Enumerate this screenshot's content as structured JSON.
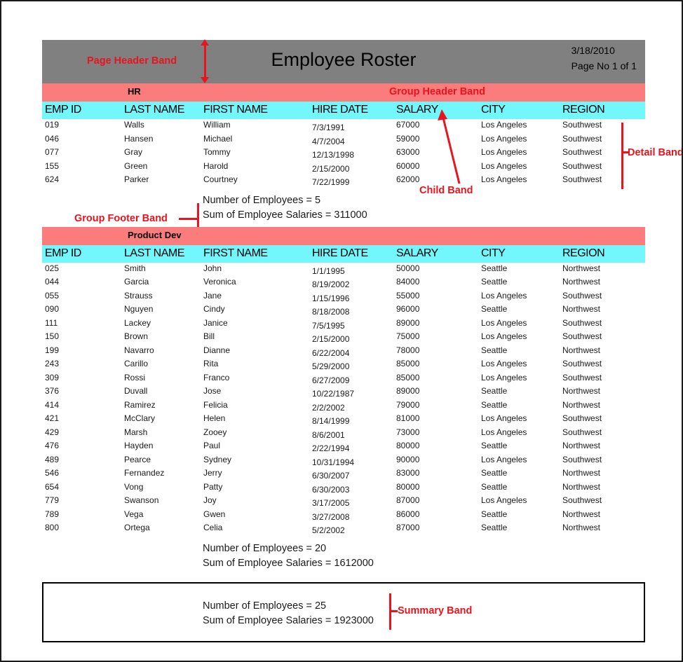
{
  "report": {
    "title": "Employee Roster",
    "date": "3/18/2010",
    "page_no": "Page No 1 of 1",
    "columns": [
      "EMP ID",
      "LAST NAME",
      "FIRST NAME",
      "HIRE DATE",
      "SALARY",
      "CITY",
      "REGION"
    ],
    "groups": [
      {
        "name": "HR",
        "rows": [
          {
            "emp_id": "019",
            "last": "Walls",
            "first": "William",
            "hire": "7/3/1991",
            "salary": "67000",
            "city": "Los Angeles",
            "region": "Southwest"
          },
          {
            "emp_id": "046",
            "last": "Hansen",
            "first": "Michael",
            "hire": "4/7/2004",
            "salary": "59000",
            "city": "Los Angeles",
            "region": "Southwest"
          },
          {
            "emp_id": "077",
            "last": "Gray",
            "first": "Tommy",
            "hire": "12/13/1998",
            "salary": "63000",
            "city": "Los Angeles",
            "region": "Southwest"
          },
          {
            "emp_id": "155",
            "last": "Green",
            "first": "Harold",
            "hire": "2/15/2000",
            "salary": "60000",
            "city": "Los Angeles",
            "region": "Southwest"
          },
          {
            "emp_id": "624",
            "last": "Parker",
            "first": "Courtney",
            "hire": "7/22/1999",
            "salary": "62000",
            "city": "Los Angeles",
            "region": "Southwest"
          }
        ],
        "footer": {
          "count_line": "Number of Employees = 5",
          "sum_line": "Sum of Employee Salaries = 311000"
        }
      },
      {
        "name": "Product Dev",
        "rows": [
          {
            "emp_id": "025",
            "last": "Smith",
            "first": "John",
            "hire": "1/1/1995",
            "salary": "50000",
            "city": "Seattle",
            "region": "Northwest"
          },
          {
            "emp_id": "044",
            "last": "Garcia",
            "first": "Veronica",
            "hire": "8/19/2002",
            "salary": "84000",
            "city": "Seattle",
            "region": "Northwest"
          },
          {
            "emp_id": "055",
            "last": "Strauss",
            "first": "Jane",
            "hire": "1/15/1996",
            "salary": "55000",
            "city": "Los Angeles",
            "region": "Southwest"
          },
          {
            "emp_id": "090",
            "last": "Nguyen",
            "first": "Cindy",
            "hire": "8/18/2008",
            "salary": "96000",
            "city": "Seattle",
            "region": "Northwest"
          },
          {
            "emp_id": "111",
            "last": "Lackey",
            "first": "Janice",
            "hire": "7/5/1995",
            "salary": "89000",
            "city": "Los Angeles",
            "region": "Southwest"
          },
          {
            "emp_id": "150",
            "last": "Brown",
            "first": "Bill",
            "hire": "2/15/2000",
            "salary": "75000",
            "city": "Los Angeles",
            "region": "Southwest"
          },
          {
            "emp_id": "199",
            "last": "Navarro",
            "first": "Dianne",
            "hire": "6/22/2004",
            "salary": "78000",
            "city": "Seattle",
            "region": "Northwest"
          },
          {
            "emp_id": "243",
            "last": "Carillo",
            "first": "Rita",
            "hire": "5/29/2000",
            "salary": "85000",
            "city": "Los Angeles",
            "region": "Southwest"
          },
          {
            "emp_id": "309",
            "last": "Rossi",
            "first": "Franco",
            "hire": "6/27/2009",
            "salary": "85000",
            "city": "Los Angeles",
            "region": "Southwest"
          },
          {
            "emp_id": "376",
            "last": "Duvall",
            "first": "Jose",
            "hire": "10/22/1987",
            "salary": "89000",
            "city": "Seattle",
            "region": "Northwest"
          },
          {
            "emp_id": "414",
            "last": "Ramirez",
            "first": "Felicia",
            "hire": "2/2/2002",
            "salary": "79000",
            "city": "Seattle",
            "region": "Northwest"
          },
          {
            "emp_id": "421",
            "last": "McClary",
            "first": "Helen",
            "hire": "8/14/1999",
            "salary": "81000",
            "city": "Los Angeles",
            "region": "Southwest"
          },
          {
            "emp_id": "429",
            "last": "Marsh",
            "first": "Zooey",
            "hire": "8/6/2001",
            "salary": "73000",
            "city": "Los Angeles",
            "region": "Southwest"
          },
          {
            "emp_id": "476",
            "last": "Hayden",
            "first": "Paul",
            "hire": "2/22/1994",
            "salary": "80000",
            "city": "Seattle",
            "region": "Northwest"
          },
          {
            "emp_id": "489",
            "last": "Pearce",
            "first": "Sydney",
            "hire": "10/31/1994",
            "salary": "90000",
            "city": "Los Angeles",
            "region": "Southwest"
          },
          {
            "emp_id": "546",
            "last": "Fernandez",
            "first": "Jerry",
            "hire": "6/30/2007",
            "salary": "83000",
            "city": "Seattle",
            "region": "Northwest"
          },
          {
            "emp_id": "654",
            "last": "Vong",
            "first": "Patty",
            "hire": "6/30/2003",
            "salary": "80000",
            "city": "Seattle",
            "region": "Northwest"
          },
          {
            "emp_id": "779",
            "last": "Swanson",
            "first": "Joy",
            "hire": "3/17/2005",
            "salary": "87000",
            "city": "Los Angeles",
            "region": "Southwest"
          },
          {
            "emp_id": "789",
            "last": "Vega",
            "first": "Gwen",
            "hire": "3/27/2008",
            "salary": "86000",
            "city": "Seattle",
            "region": "Northwest"
          },
          {
            "emp_id": "800",
            "last": "Ortega",
            "first": "Celia",
            "hire": "5/2/2002",
            "salary": "87000",
            "city": "Seattle",
            "region": "Northwest"
          }
        ],
        "footer": {
          "count_line": "Number of Employees = 20",
          "sum_line": "Sum of Employee Salaries = 1612000"
        }
      }
    ],
    "summary": {
      "count_line": "Number of Employees = 25",
      "sum_line": "Sum of Employee Salaries = 1923000"
    }
  },
  "annotations": {
    "page_header_band": "Page Header Band",
    "group_header_band": "Group Header Band",
    "child_band": "Child Band",
    "detail_band": "Detail Band",
    "group_footer_band": "Group Footer Band",
    "summary_band": "Summary Band"
  },
  "colors": {
    "page_header_bg": "#808080",
    "group_header_bg": "#fa7c7c",
    "column_header_bg": "#72f7fd",
    "annotation": "#e8141e",
    "border": "#000000"
  }
}
